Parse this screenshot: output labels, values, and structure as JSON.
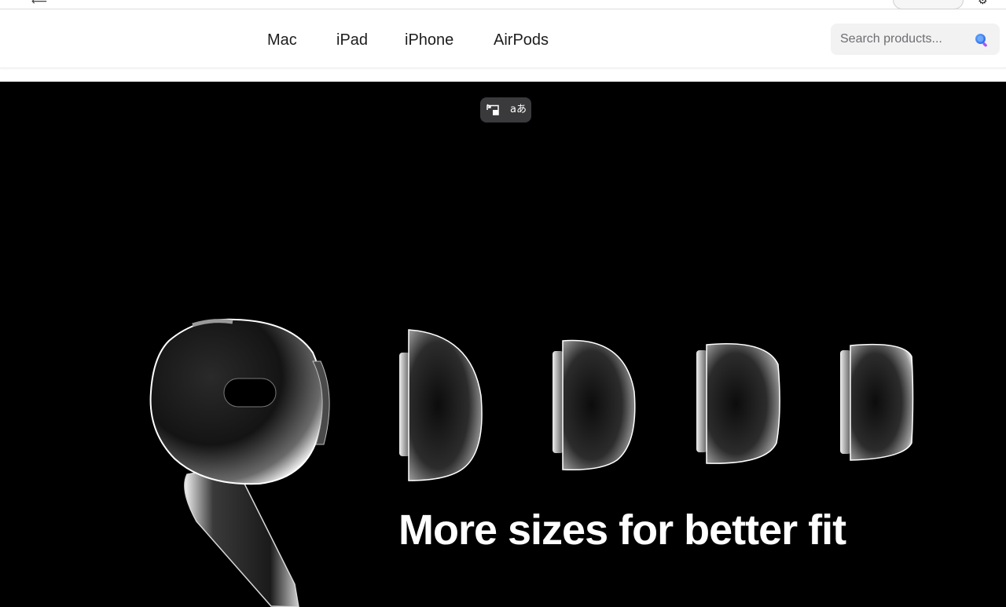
{
  "nav": {
    "links": [
      "Mac",
      "iPad",
      "iPhone",
      "AirPods"
    ],
    "search": {
      "placeholder": "Search products...",
      "value": ""
    }
  },
  "hero": {
    "headline": "More sizes for better fit",
    "toolbar": {
      "translate_glyph": "aあ"
    }
  },
  "icons": {
    "search": "search-icon",
    "picture_in_picture": "pip-icon",
    "translate": "translate-icon"
  },
  "colors": {
    "nav_background": "#ffffff",
    "hero_background": "#000000",
    "headline": "#ffffff",
    "search_background": "#f2f2f2",
    "search_icon": "#3b82f6"
  }
}
